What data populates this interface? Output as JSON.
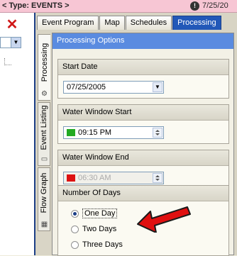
{
  "window": {
    "type_label": "< Type: EVENTS >",
    "date_text": "7/25/20",
    "clock_icon": "clock-icon"
  },
  "left_strip": {
    "close_icon": "close-icon"
  },
  "top_tabs": [
    {
      "label": "Event Program",
      "active": false
    },
    {
      "label": "Map",
      "active": false
    },
    {
      "label": "Schedules",
      "active": false
    },
    {
      "label": "Processing",
      "active": true
    }
  ],
  "side_tabs": [
    {
      "label": "Processing",
      "active": true
    },
    {
      "label": "Event Listing",
      "active": false
    },
    {
      "label": "Flow Graph",
      "active": false
    }
  ],
  "section_header": "Processing Options",
  "start_date": {
    "title": "Start Date",
    "value": "07/25/2005"
  },
  "water_window_start": {
    "title": "Water Window Start",
    "value": "09:15 PM",
    "swatch_color": "#22aa22"
  },
  "water_window_end": {
    "title": "Water Window End",
    "value": "06:30 AM",
    "swatch_color": "#dd1111"
  },
  "number_of_days": {
    "title": "Number Of Days",
    "options": [
      {
        "label": "One Day",
        "checked": true
      },
      {
        "label": "Two Days",
        "checked": false
      },
      {
        "label": "Three Days",
        "checked": false
      }
    ]
  },
  "colors": {
    "title_bar": "#f7c6d4",
    "active_tab": "#2258b8",
    "section_header": "#5a8be0",
    "annotation_arrow": "#e01010"
  }
}
